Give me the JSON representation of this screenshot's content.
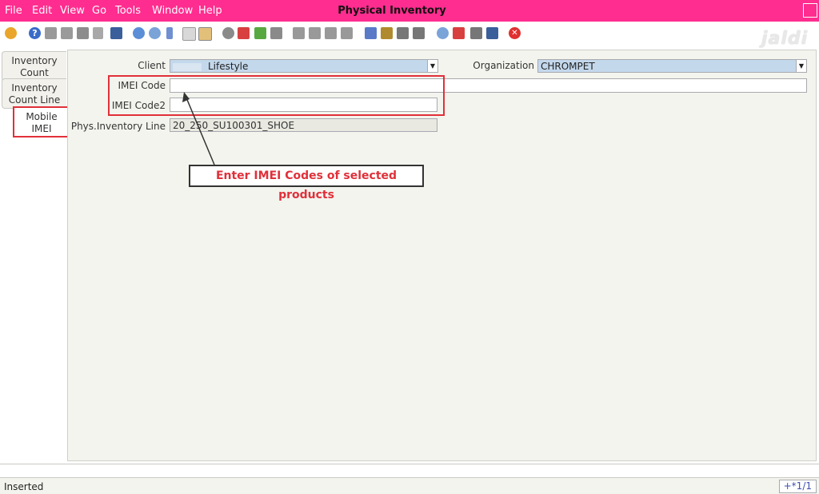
{
  "menu": {
    "file": "File",
    "edit": "Edit",
    "view": "View",
    "go": "Go",
    "tools": "Tools",
    "window": "Window",
    "help": "Help"
  },
  "window_title": "Physical Inventory",
  "logo_text": "jaldi",
  "toolbar_icons": [
    "undo-icon",
    "help-icon",
    "new-icon",
    "copy-icon",
    "delete-icon",
    "delete-selection-icon",
    "save-icon",
    "refresh-icon",
    "find-icon",
    "attachment-icon",
    "chat-icon",
    "history-icon",
    "grid-toggle-icon",
    "home-icon",
    "back-icon",
    "forward-icon",
    "first-record-icon",
    "previous-record-icon",
    "next-record-icon",
    "last-record-icon",
    "report-icon",
    "archive-icon",
    "print-preview-icon",
    "print-icon",
    "zoom-across-icon",
    "workflow-icon",
    "product-info-icon",
    "exit-icon",
    "close-window-icon"
  ],
  "tabs": {
    "inventory_count": "Inventory Count",
    "inventory_count_line": "Inventory Count Line",
    "mobile_imei": "Mobile IMEI"
  },
  "form": {
    "client_label": "Client",
    "client_value": "Lifestyle",
    "organization_label": "Organization",
    "organization_value": "CHROMPET",
    "imei_code_label": "IMEI Code",
    "imei_code_value": "",
    "imei_code2_label": "IMEI Code2",
    "imei_code2_value": "",
    "phys_inventory_line_label": "Phys.Inventory Line",
    "phys_inventory_line_value": "20_250_SU100301_SHOE"
  },
  "annotation": "Enter IMEI Codes of selected products",
  "status": {
    "text": "Inserted",
    "record": "+*1/1"
  },
  "colors": {
    "menu_bar": "#ff2d8f",
    "annotation_red": "#e0303a",
    "combo_fill": "#c4d8ec"
  }
}
